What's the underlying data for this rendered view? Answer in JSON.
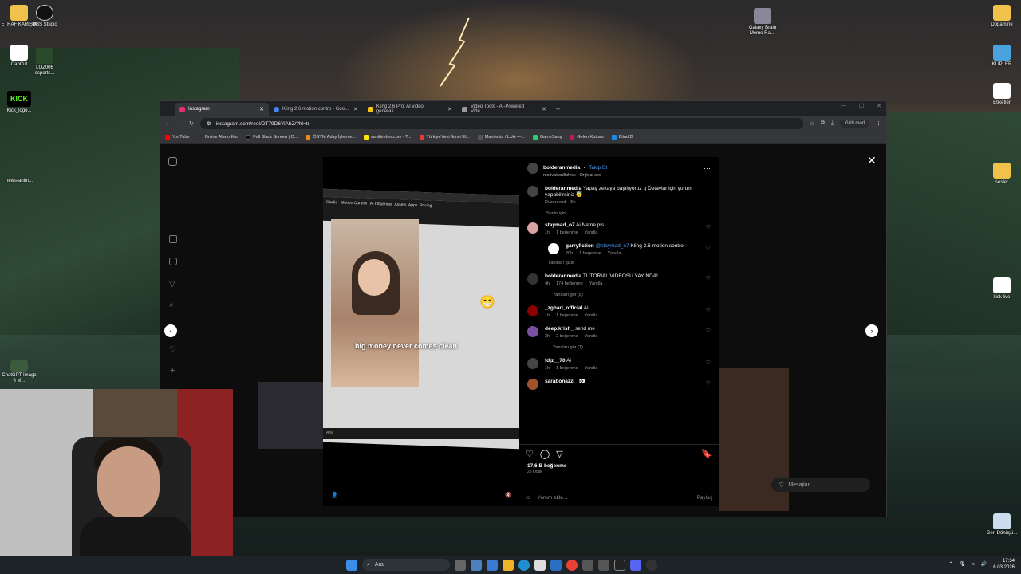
{
  "desktop": {
    "left_icons": [
      {
        "label": "ETRAF KARIŞIK",
        "icon": "folder-icon"
      },
      {
        "label": "OBS Studio",
        "icon": "obs-icon"
      },
      {
        "label": "CapCut",
        "icon": "capcut-icon"
      },
      {
        "label": "LOZ006 esports...",
        "icon": "app-icon"
      },
      {
        "label": "Kick_logo...",
        "icon": "kick-icon"
      },
      {
        "label": "news-anim...",
        "icon": "file-icon"
      },
      {
        "label": "ChatGPT Image 6 M...",
        "icon": "image-icon"
      }
    ],
    "right_icons": [
      {
        "label": "Dopamine",
        "icon": "folder-icon"
      },
      {
        "label": "KLİPLER",
        "icon": "folder-icon"
      },
      {
        "label": "Etiketler",
        "icon": "file-icon"
      },
      {
        "label": "sesler",
        "icon": "folder-icon"
      },
      {
        "label": "kick live",
        "icon": "image-icon"
      },
      {
        "label": "Geri Dönüşü...",
        "icon": "recycle-bin-icon"
      }
    ],
    "center_icon": {
      "label": "Galaxy Brain Meme Rai...",
      "icon": "image-icon"
    }
  },
  "browser": {
    "tabs": [
      {
        "label": "Instagram",
        "active": true,
        "color": "#e1306c"
      },
      {
        "label": "Kling 2.6 motion contro - Goo...",
        "active": false,
        "color": "#4285f4"
      },
      {
        "label": "Kling 2.6 Pro: AI video generati...",
        "active": false,
        "color": "#f5c518"
      },
      {
        "label": "Video Tools - AI-Powered Vide...",
        "active": false,
        "color": "#999999"
      }
    ],
    "url": "instagram.com/reel/DT79D6YiAhZ/?hl=tr",
    "incognito": "Gizli mod",
    "bookmarks": [
      {
        "label": "YouTube",
        "color": "#ff0000"
      },
      {
        "label": "Online Alarm Kur",
        "color": "#333333"
      },
      {
        "label": "Full Black Screen | O...",
        "color": "#111111"
      },
      {
        "label": "ÖSYM Aday İşlemle...",
        "color": "#e88a1a"
      },
      {
        "label": "sahibinden.com - T...",
        "color": "#ffe800"
      },
      {
        "label": "Türkiye'deki İkinci El...",
        "color": "#e53935"
      },
      {
        "label": "Manifests / LUA —...",
        "color": "#555555"
      },
      {
        "label": "GameSatış",
        "color": "#2ecc71"
      },
      {
        "label": "Gelen Kutusu",
        "color": "#c2185b"
      },
      {
        "label": "BlindID",
        "color": "#1e88e5"
      }
    ]
  },
  "reel": {
    "subtitle": "big money never comes clean",
    "emoji": "😁",
    "video_ui_labels": {
      "studio": "Studio",
      "motion": "Motion Control",
      "influencer": "AI Influencer",
      "assets": "Assets",
      "apps": "Apps",
      "pricing": "Pricing",
      "search": "Ara"
    }
  },
  "post": {
    "author": "bolderanmedia",
    "follow": "Takip Et",
    "audio": "motivation8blvck • Orijinal ses",
    "caption": "Yapay zekaya bayılıyoruz :) Detaylar için yorum yapabilirsiniz 😇",
    "caption_meta": "Düzenlendi · 5h",
    "sort_label": "Senin için ⌄",
    "likes": "17,6 B beğenme",
    "date": "25 Ocak",
    "comment_placeholder": "Yorum ekle...",
    "share": "Paylaş",
    "messages": "Mesajlar"
  },
  "comments": [
    {
      "user": "staymad_o7",
      "text": "Ai Name pls",
      "time": "1h",
      "likes": "1 beğenme",
      "reply": "Yanıtla",
      "avatar_color": "#d9a3a3"
    },
    {
      "user": "garryfiction",
      "mention": "@staymad_o7",
      "text": "Kling 2.6 motion control",
      "time": "20h",
      "likes": "1 beğenme",
      "reply": "Yanıtla",
      "is_reply": true,
      "avatar_color": "#ffffff"
    },
    {
      "user": "bolderanmedia",
      "text": "TUTORIAL VIDEOSU YAYINDA!",
      "time": "4h",
      "likes": "174 beğenme",
      "reply": "Yanıtla",
      "avatar_color": "#333333"
    },
    {
      "user": "_zgharl_official",
      "text": "Ai",
      "time": "1h",
      "likes": "1 beğenme",
      "reply": "Yanıtla",
      "avatar_color": "#8b0000"
    },
    {
      "user": "deep.krish_",
      "text": "send me",
      "time": "3h",
      "likes": "2 beğenme",
      "reply": "Yanıtla",
      "avatar_color": "#7b4fa0"
    },
    {
      "user": "fdjz__70",
      "text": "Ai",
      "time": "1h",
      "likes": "1 beğenme",
      "reply": "Yanıtla",
      "avatar_color": "#444444"
    },
    {
      "user": "sarabonazzi_",
      "text": "👀",
      "time": "",
      "likes": "",
      "reply": "",
      "avatar_color": "#a0522d"
    }
  ],
  "reply_toggles": {
    "hide": "Yanıtları gizle",
    "see_8": "Yanıtları gör (8)",
    "see_1": "Yanıtları gör (1)"
  },
  "taskbar": {
    "search": "Ara",
    "time": "17:34",
    "date": "6.03.2026"
  }
}
